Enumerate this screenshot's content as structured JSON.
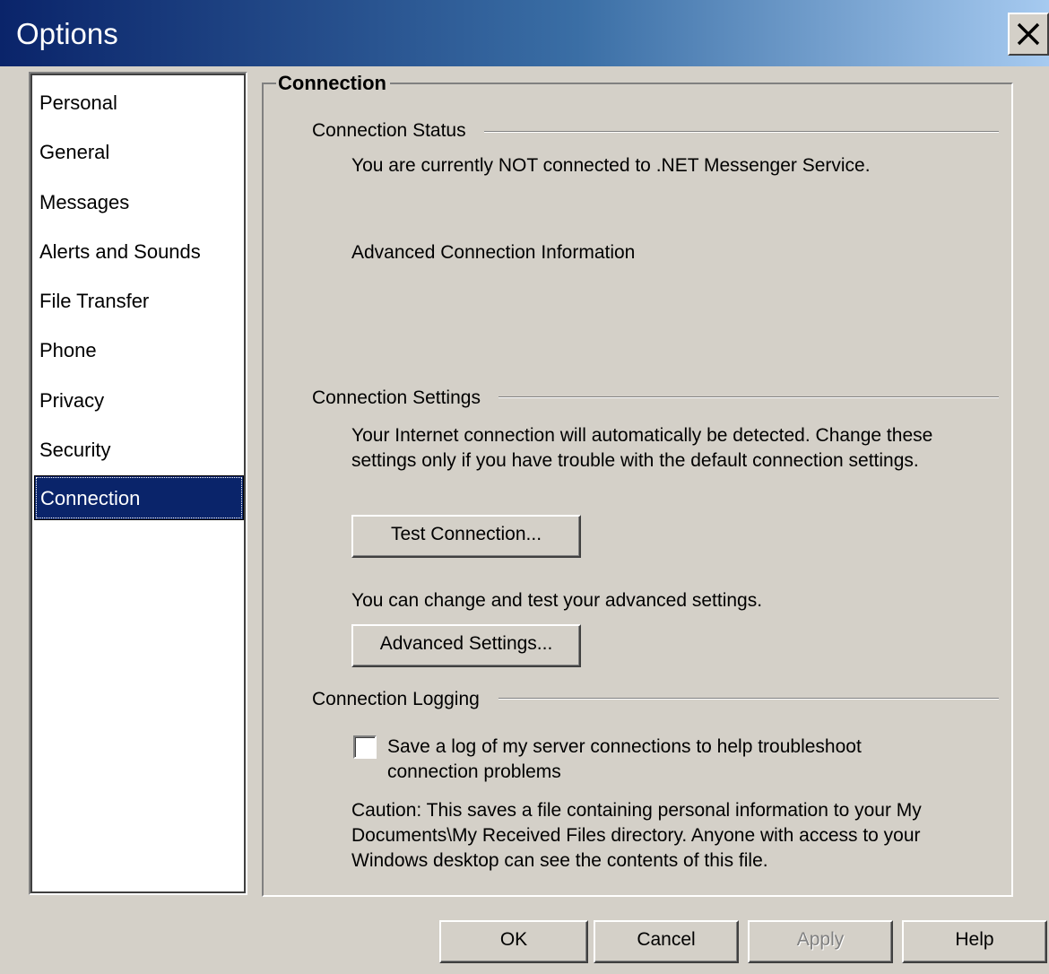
{
  "window": {
    "title": "Options",
    "close_symbol": "×"
  },
  "sidebar": {
    "items": [
      {
        "label": "Personal"
      },
      {
        "label": "General"
      },
      {
        "label": "Messages"
      },
      {
        "label": "Alerts and Sounds"
      },
      {
        "label": "File Transfer"
      },
      {
        "label": "Phone"
      },
      {
        "label": "Privacy"
      },
      {
        "label": "Security"
      },
      {
        "label": "Connection",
        "selected": true
      }
    ]
  },
  "panel": {
    "title": "Connection",
    "status": {
      "heading": "Connection Status",
      "message": "You are currently NOT connected to .NET Messenger Service.",
      "advanced_info": "Advanced Connection Information"
    },
    "settings": {
      "heading": "Connection Settings",
      "description": "Your Internet connection will automatically be detected.  Change these settings only if you have trouble with the default connection settings.",
      "test_button": "Test Connection...",
      "advanced_note": "You can change and test your advanced settings.",
      "advanced_button": "Advanced Settings..."
    },
    "logging": {
      "heading": "Connection Logging",
      "checkbox_label": "Save a log of my server connections to help troubleshoot connection problems",
      "checked": false,
      "caution": "Caution:  This saves a file containing personal information to your My Documents\\My Received Files directory.  Anyone with access to your Windows desktop can see the contents of this file."
    }
  },
  "footer": {
    "ok": "OK",
    "cancel": "Cancel",
    "apply": "Apply",
    "help": "Help"
  }
}
